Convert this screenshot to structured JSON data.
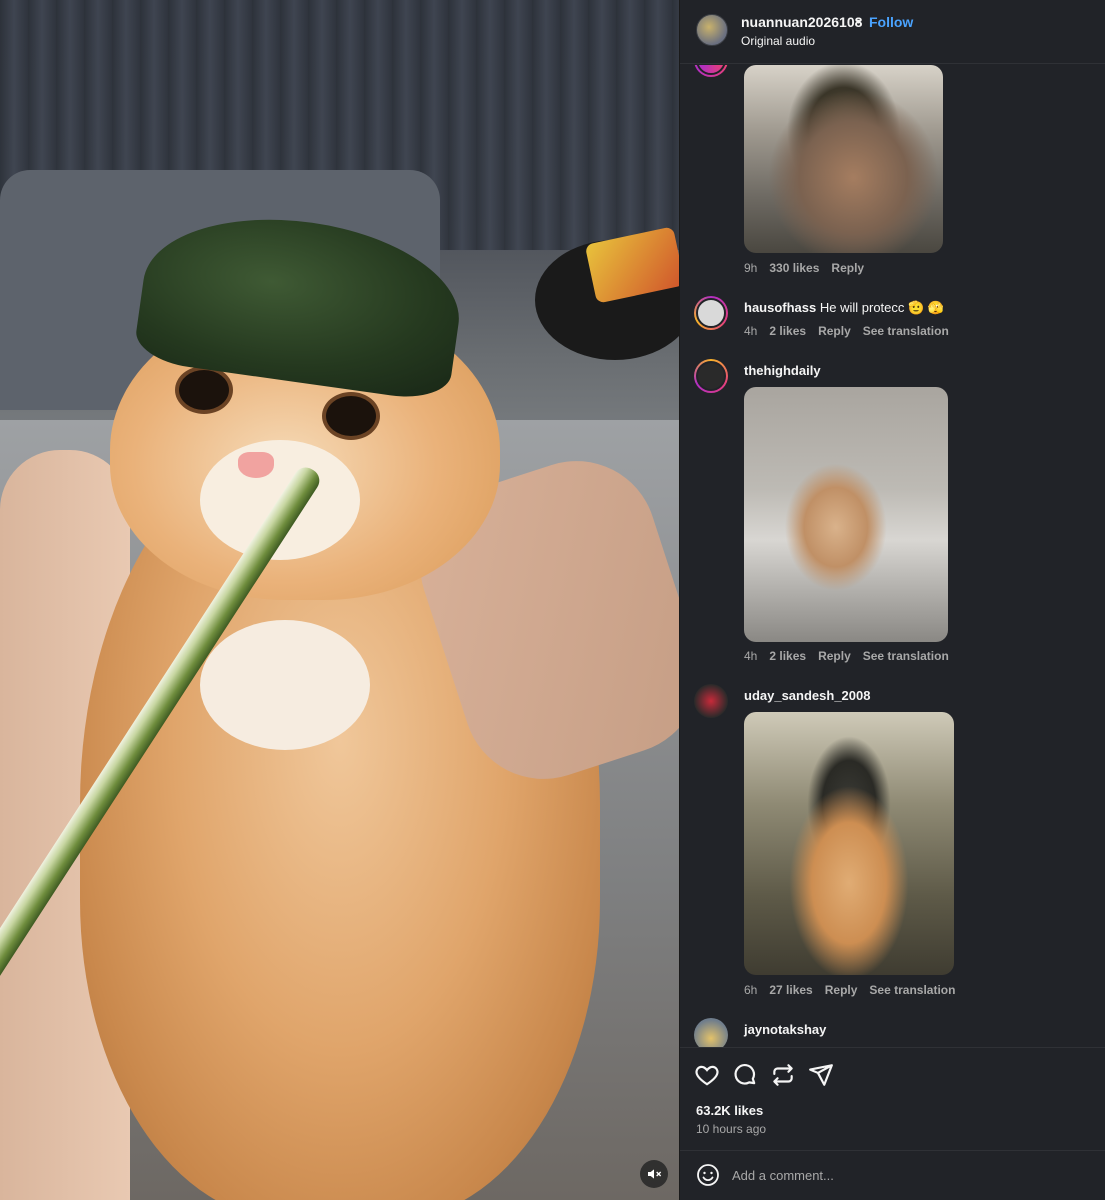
{
  "post": {
    "username": "nuannuan2026108",
    "separator": "•",
    "follow_label": "Follow",
    "audio": "Original audio",
    "likes": "63.2K likes",
    "posted": "10 hours ago",
    "comment_placeholder": "Add a comment..."
  },
  "comments": [
    {
      "username": "",
      "text": "",
      "time": "9h",
      "likes": "330 likes",
      "reply": "Reply",
      "translation": ""
    },
    {
      "username": "hausofhass",
      "text": "He will protecc 🫡 🫣",
      "time": "4h",
      "likes": "2 likes",
      "reply": "Reply",
      "translation": "See translation"
    },
    {
      "username": "thehighdaily",
      "text": "",
      "time": "4h",
      "likes": "2 likes",
      "reply": "Reply",
      "translation": "See translation"
    },
    {
      "username": "uday_sandesh_2008",
      "text": "",
      "time": "6h",
      "likes": "27 likes",
      "reply": "Reply",
      "translation": "See translation"
    },
    {
      "username": "jaynotakshay",
      "text": "",
      "time": "",
      "likes": "",
      "reply": "",
      "translation": ""
    }
  ],
  "icons": {
    "like": "heart-icon",
    "comment": "comment-icon",
    "repost": "repost-icon",
    "share": "share-icon",
    "mute": "muted-speaker-icon",
    "emoji": "emoji-icon"
  },
  "colors": {
    "panel_bg": "#212328",
    "follow": "#4aa3ff",
    "muted_text": "#a8a8a8"
  }
}
